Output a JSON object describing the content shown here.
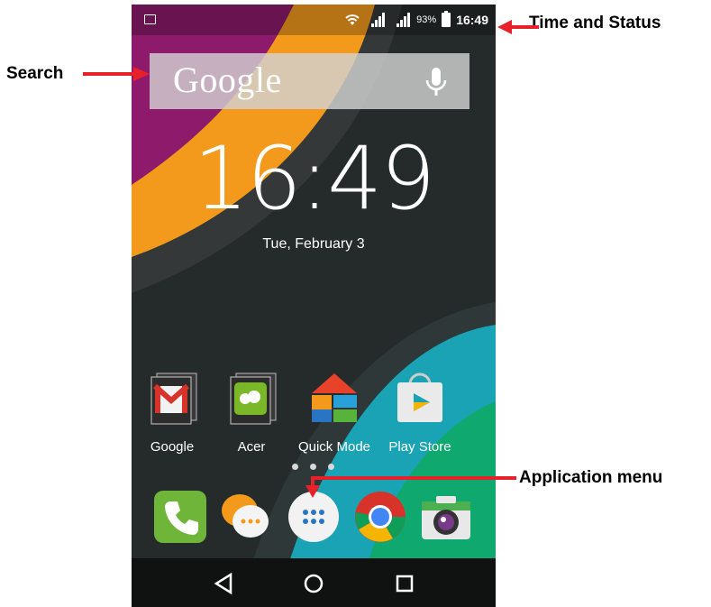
{
  "status_bar": {
    "battery_percent": "93%",
    "time": "16:49"
  },
  "search": {
    "logo_text": "Google"
  },
  "clock": {
    "time": "16:49",
    "date": "Tue, February 3"
  },
  "apps": [
    {
      "label": "Google",
      "icon": "gmail-folder-icon"
    },
    {
      "label": "Acer",
      "icon": "acer-folder-icon"
    },
    {
      "label": "Quick Mode",
      "icon": "quick-mode-icon"
    },
    {
      "label": "Play Store",
      "icon": "play-store-icon"
    }
  ],
  "page_indicator": {
    "pages": 3
  },
  "dock": [
    {
      "icon": "phone-icon"
    },
    {
      "icon": "messaging-icon"
    },
    {
      "icon": "app-drawer-icon"
    },
    {
      "icon": "chrome-icon"
    },
    {
      "icon": "camera-icon"
    }
  ],
  "nav": [
    {
      "icon": "back-icon"
    },
    {
      "icon": "home-icon"
    },
    {
      "icon": "recents-icon"
    }
  ],
  "annotations": {
    "time_status": "Time and Status",
    "search": "Search",
    "app_menu": "Application menu"
  },
  "colors": {
    "annotation_arrow": "#e8202a",
    "wallpaper_orange": "#f39a1c",
    "wallpaper_magenta": "#8e1a6c",
    "wallpaper_teal": "#1aa3b4",
    "wallpaper_green": "#0fa970"
  }
}
